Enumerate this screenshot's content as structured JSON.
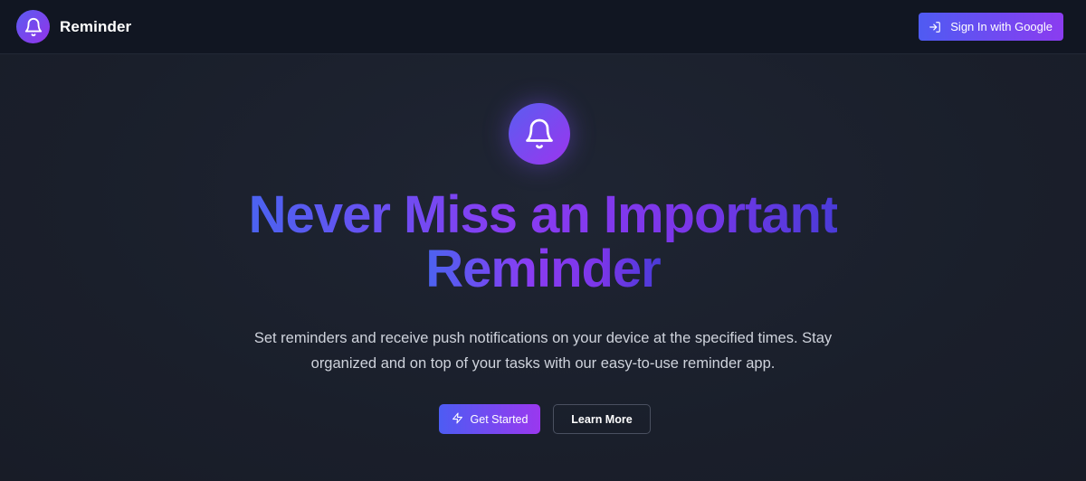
{
  "header": {
    "brand_name": "Reminder",
    "logo_icon": "bell-icon",
    "signin_label": "Sign In with Google",
    "signin_icon": "sign-in-icon"
  },
  "hero": {
    "icon": "bell-icon",
    "title_line1": "Never Miss an Important",
    "title_line2": "Reminder",
    "subtitle_line1": "Set reminders and receive push notifications on your device at the specified times. Stay",
    "subtitle_line2": "organized and on top of your tasks with our easy-to-use reminder app.",
    "primary_label": "Get Started",
    "primary_icon": "lightning-icon",
    "secondary_label": "Learn More"
  },
  "colors": {
    "background": "#1b202c",
    "header_bg": "#111622",
    "accent_start": "#4f5bf2",
    "accent_end": "#9333ea",
    "text_muted": "#cfd3dc"
  }
}
